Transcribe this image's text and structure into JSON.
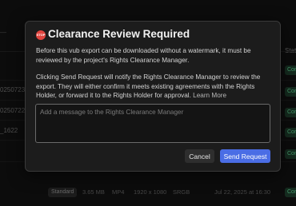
{
  "background": {
    "header_fragment": "Stat",
    "row_fragments": [
      {
        "id_text": "0250723",
        "status": "Com"
      },
      {
        "id_text": "0250722",
        "status": "Com"
      },
      {
        "id_text": "_1622",
        "status": "Com"
      },
      {
        "id_text": "",
        "status": "Com"
      },
      {
        "id_text": "",
        "status": "Com"
      }
    ],
    "left_marker": "—",
    "bottom_row": {
      "tier": "Standard",
      "size": "3.65 MB",
      "format": "MP4",
      "resolution": "1920 x 1080",
      "color_space": "SRGB",
      "date": "Jul 22, 2025 at 16:30",
      "status": "Com"
    }
  },
  "modal": {
    "icon_text": "STOP",
    "title": "Clearance Review Required",
    "paragraph1": "Before this vub export can be downloaded without a watermark, it must be reviewed by the project's Rights Clearance Manager.",
    "paragraph2": "Clicking Send Request will notify the Rights Clearance Manager to review the export. They will either confirm it meets existing agreements with the Rights Holder, or forward it to the Rights Holder for approval.",
    "learn_more": "Learn More",
    "message_placeholder": "Add a message to the Rights Clearance Manager",
    "message_value": "",
    "cancel_label": "Cancel",
    "send_label": "Send Request"
  },
  "colors": {
    "accent": "#4a6de5",
    "alert": "#e0443e",
    "status_complete": "#5bc98c"
  }
}
